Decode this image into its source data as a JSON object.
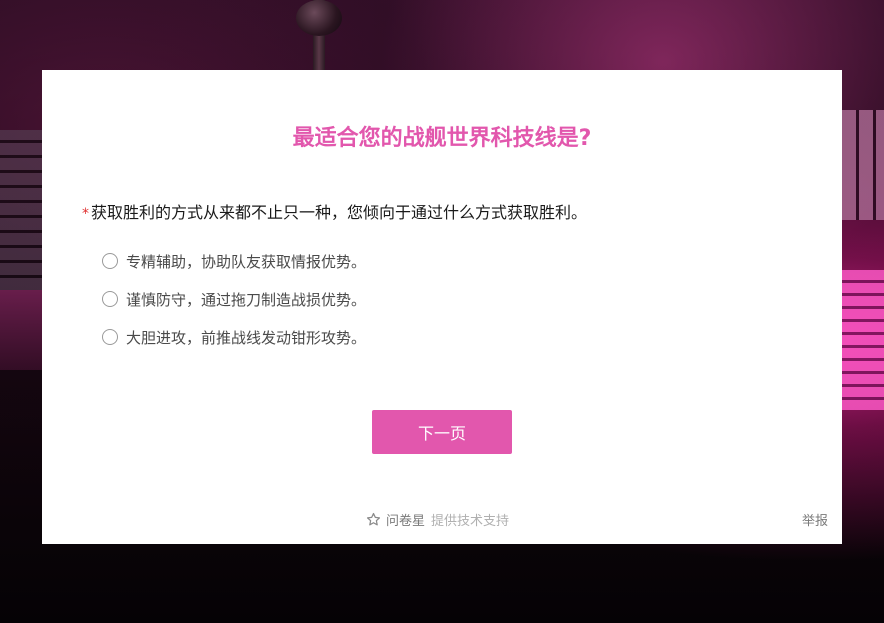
{
  "survey": {
    "title": "最适合您的战舰世界科技线是?",
    "question": {
      "required_mark": "*",
      "text": "获取胜利的方式从来都不止只一种，您倾向于通过什么方式获取胜利。",
      "options": [
        {
          "label": "专精辅助，协助队友获取情报优势。",
          "selected": false
        },
        {
          "label": "谨慎防守，通过拖刀制造战损优势。",
          "selected": false
        },
        {
          "label": "大胆进攻，前推战线发动钳形攻势。",
          "selected": false
        }
      ]
    },
    "next_button_label": "下一页"
  },
  "footer": {
    "brand_icon": "star-outline-icon",
    "brand_name": "问卷星",
    "brand_support": "提供技术支持",
    "report_label": "举报"
  },
  "colors": {
    "accent": "#e257ad",
    "required": "#e03030",
    "text": "#1a1a1a",
    "muted": "#8a8a8a"
  }
}
